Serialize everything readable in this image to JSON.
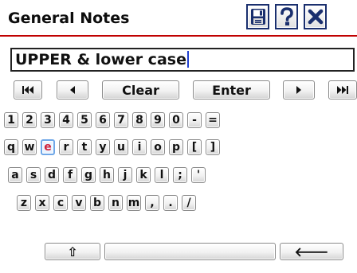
{
  "header": {
    "title": "General Notes"
  },
  "input": {
    "value": "UPPER & lower case"
  },
  "keyboard": {
    "nav": {
      "clear": "Clear",
      "enter": "Enter"
    },
    "row1": [
      "1",
      "2",
      "3",
      "4",
      "5",
      "6",
      "7",
      "8",
      "9",
      "0",
      "-",
      "="
    ],
    "row2": [
      "q",
      "w",
      "e",
      "r",
      "t",
      "y",
      "u",
      "i",
      "o",
      "p",
      "[",
      "]"
    ],
    "row3": [
      "a",
      "s",
      "d",
      "f",
      "g",
      "h",
      "j",
      "k",
      "l",
      ";",
      "'"
    ],
    "row4": [
      "z",
      "x",
      "c",
      "v",
      "b",
      "n",
      "m",
      ",",
      ".",
      "/"
    ],
    "bottom": {
      "shift": "⇧",
      "backspace": "🡐"
    },
    "highlighted_key": "e"
  },
  "colors": {
    "title_rule": "#c00000",
    "header_icons": "#1a2f6e",
    "caret": "#1f3fd0",
    "highlight_border": "#6fa7e8",
    "highlight_text": "#d0213a"
  },
  "icons": [
    "save-icon",
    "help-icon",
    "close-icon",
    "skip-to-start-icon",
    "arrow-left-icon",
    "arrow-right-icon",
    "skip-to-end-icon",
    "shift-icon",
    "backspace-icon"
  ]
}
